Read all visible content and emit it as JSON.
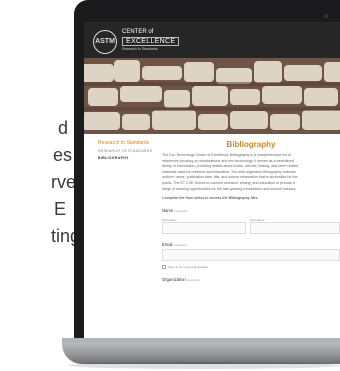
{
  "background_text": [
    "d",
    "es",
    "rves",
    "E",
    "ting,"
  ],
  "header": {
    "logo_text": "ASTM",
    "center_of": "CENTER of",
    "excellence": "EXCELLENCE",
    "tagline": "Research to Standards"
  },
  "sidebar": {
    "section": "Research to Standards",
    "sub": "RESEARCH TO STANDARDS",
    "active_item": "BIBLIOGRAPHY"
  },
  "main": {
    "title": "Bibliography",
    "paragraph_lines": [
      "The Exo Technology Center of Excellence Bibliography is a comprehensive list of",
      "references focusing on exoskeletons and exo technology. It serves as a centralized",
      "library of information, providing details about books, articles, testing, and other related",
      "materials used for research and education. The well-organized bibliography includes",
      "authors' name, publication date, title, and source information that is accessible for the",
      "public. The ET COE thrives to connect research, testing, and education to provide a",
      "range of learning opportunities for the fast-growing exoskeleton and exosuit industry."
    ],
    "instruction": "Complete the form below to access the Bibliography files.",
    "form": {
      "name_label": "Name",
      "required_note": "(required)",
      "first_name_label": "First Name",
      "last_name_label": "Last Name",
      "email_label": "Email",
      "checkbox_label": "Sign up for news and updates",
      "organization_label": "Organization"
    }
  },
  "colors": {
    "accent": "#c88a2c",
    "header_bg": "#262626",
    "bezel": "#1b1b1d"
  }
}
